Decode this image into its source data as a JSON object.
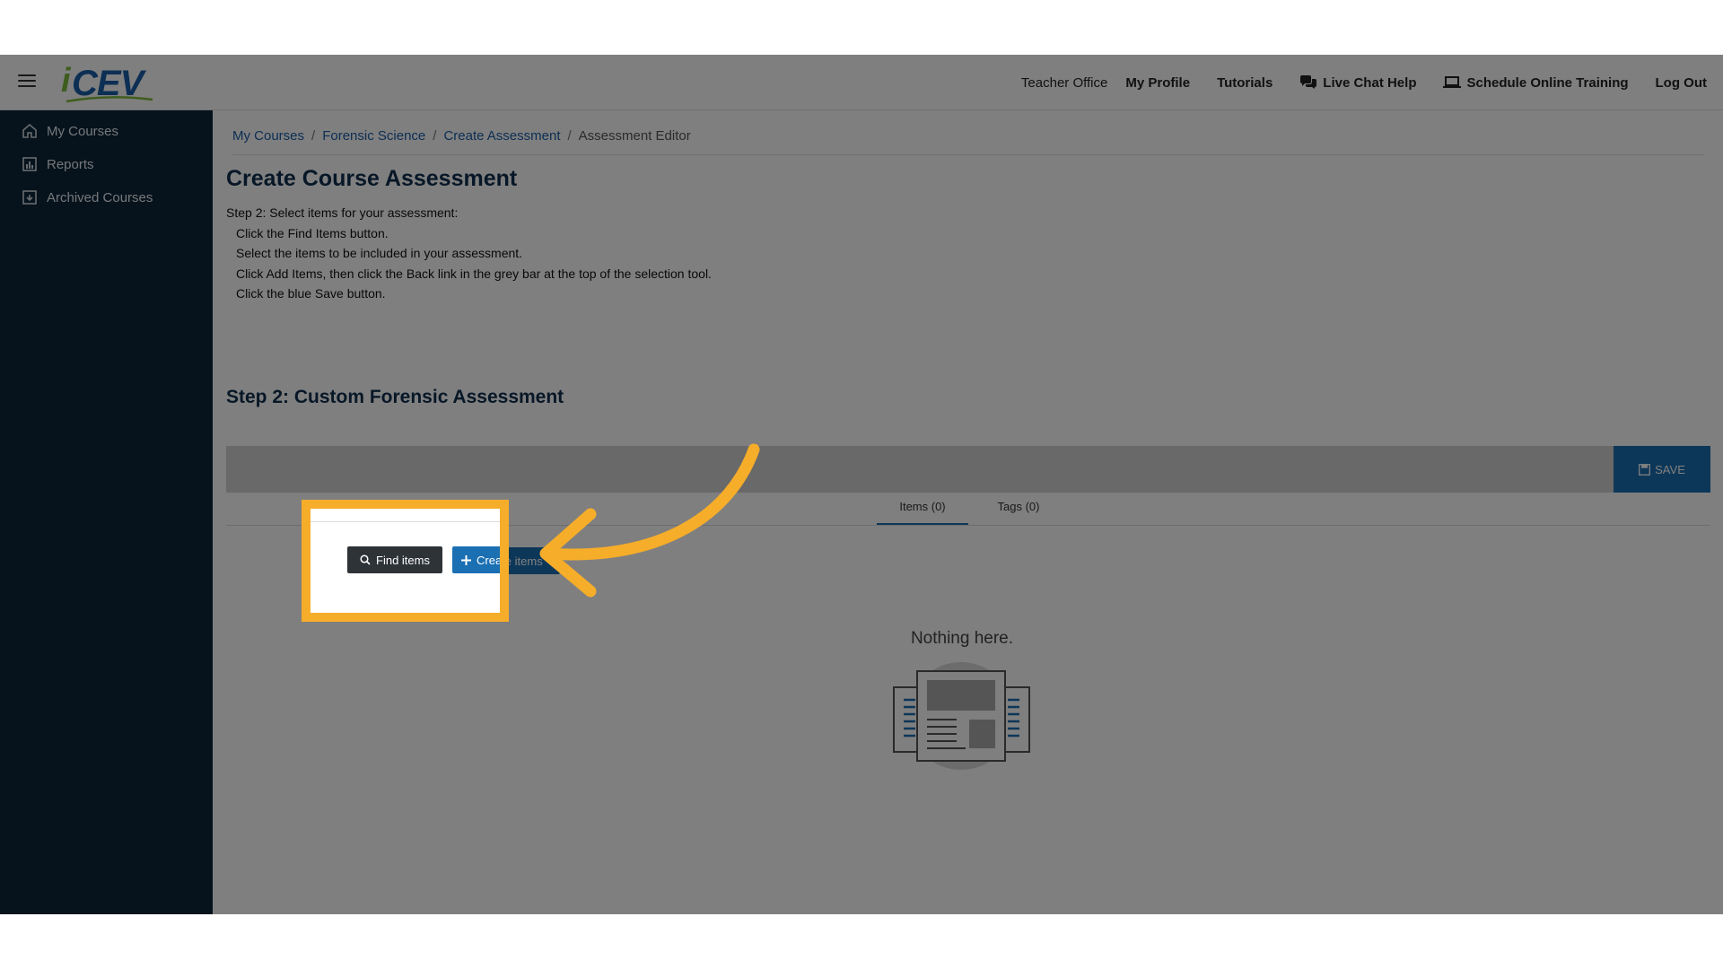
{
  "header": {
    "logo_text": "CEV",
    "logo_i": "i",
    "nav": {
      "teacher_office": "Teacher Office",
      "my_profile": "My Profile",
      "tutorials": "Tutorials",
      "live_chat": "Live Chat Help",
      "schedule_training": "Schedule Online Training",
      "log_out": "Log Out"
    }
  },
  "sidebar": {
    "items": [
      {
        "label": "My Courses",
        "icon": "home-icon"
      },
      {
        "label": "Reports",
        "icon": "chart-icon"
      },
      {
        "label": "Archived Courses",
        "icon": "archive-icon"
      }
    ]
  },
  "breadcrumb": {
    "items": [
      "My Courses",
      "Forensic Science",
      "Create Assessment"
    ],
    "current": "Assessment Editor",
    "separator": "/"
  },
  "page": {
    "title": "Create Course Assessment",
    "intro": "Step 2: Select items for your assessment:",
    "steps": [
      "Click the Find Items button.",
      "Select the items to be included in your assessment.",
      "Click Add Items, then click the Back link in the grey bar at the top of the selection tool.",
      "Click the blue Save button."
    ],
    "step2_title": "Step 2: Custom Forensic Assessment"
  },
  "toolbar": {
    "save_label": "SAVE"
  },
  "tabs": [
    {
      "label": "Items (0)",
      "active": true
    },
    {
      "label": "Tags (0)",
      "active": false
    }
  ],
  "actions": {
    "find_items": "Find items",
    "create_items": "Create items"
  },
  "empty_state": {
    "text": "Nothing here."
  },
  "colors": {
    "sidebar_bg": "#0d2538",
    "primary_blue": "#1b6fb3",
    "highlight_orange": "#f6ad2a",
    "title_navy": "#0f2f4f"
  }
}
